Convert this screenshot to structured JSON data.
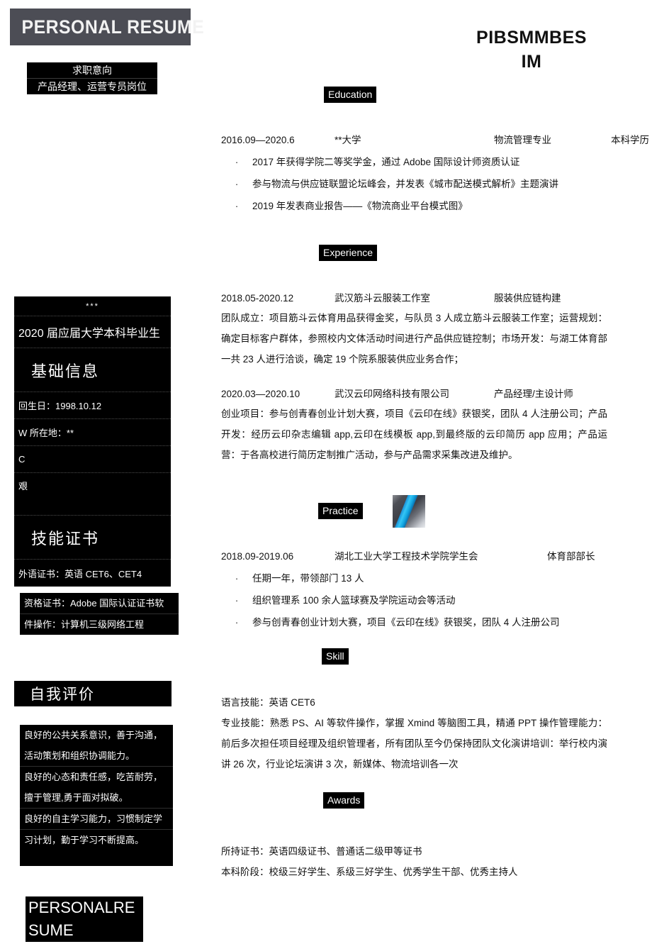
{
  "banner": {
    "title": "PERSONAL RESUME"
  },
  "objective": {
    "heading": "求职意向",
    "value": "产品经理、运营专员岗位"
  },
  "name_header": {
    "line1": "PIBSMMBES",
    "line2": "IM"
  },
  "info_panel": {
    "stars": "***",
    "graduation": "2020 届应届大学本科毕业生",
    "section_title": "基础信息",
    "rows": [
      "回生日：1998.10.12",
      "W 所在地：**",
      "C",
      "艰"
    ],
    "skill_cert_title": "技能证书",
    "foreign_cert": "外语证书：英语 CET6、CET4"
  },
  "cert_box": {
    "rows": [
      "资格证书：Adobe 国际认证证书软",
      "件操作：计算机三级网络工程"
    ]
  },
  "self_eval": {
    "title": "自我评价",
    "rows": [
      "良好的公共关系意识，善于沟通，",
      "活动策划和组织协调能力。",
      "良好的心态和责任感，吃苦耐劳，",
      "擅于管理,勇于面对拟破。",
      "良好的自主学习能力，习惯制定学",
      "习计划，勤于学习不断提高。"
    ]
  },
  "bottom_block": {
    "line1": "PERSONALRE",
    "line2": "SUME"
  },
  "sections": {
    "education": {
      "label": "Education",
      "head": {
        "date": "2016.09—2020.6",
        "org": "**大学",
        "major": "物流管理专业",
        "degree": "本科学历"
      },
      "bullets": [
        "2017 年获得学院二等奖学金，通过 Adobe 国际设计师资质认证",
        "参与物流与供应链联盟论坛峰会，并发表《城市配送模式解析》主题演讲",
        "2019 年发表商业报告——《物流商业平台模式图》"
      ],
      "bullet_dot": "·"
    },
    "experience": {
      "label": "Experience",
      "items": [
        {
          "date": "2018.05-2020.12",
          "org": "武汉筋斗云服装工作室",
          "role": "服装供应链构建",
          "desc": "团队成立：项目筋斗云体育用品获得金奖，与队员 3 人成立筋斗云服装工作室；运营规划：确定目标客户群体，参照校内文体活动时间进行产品供应链控制；市场开发：与湖工体育部一共 23 人进行洽谈，确定 19 个院系服装供应业务合作；"
        },
        {
          "date": "2020.03—2020.10",
          "org": "武汉云印网络科技有限公司",
          "role": "产品经理/主设计师",
          "desc": "创业项目：参与创青春创业计划大赛，项目《云印在线》获银奖，团队 4 人注册公司；产品开发：经历云印杂志编辑 app,云印在线模板 app,到最终版的云印简历 app 应用；产品运营：于各高校进行简历定制推广活动，参与产品需求采集改进及维护。"
        }
      ]
    },
    "practice": {
      "label": "Practice",
      "image_name": "decorative-blue-stripe-image",
      "head": {
        "date": "2018.09-2019.06",
        "org": "湖北工业大学工程技术学院学生会",
        "role": "体育部部长"
      },
      "bullets": [
        "任期一年，带领部门 13 人",
        "组织管理系 100 余人篮球赛及学院运动会等活动",
        "参与创青春创业计划大赛，项目《云印在线》获银奖，团队 4 人注册公司"
      ],
      "bullet_dot": "·"
    },
    "skill": {
      "label": "Skill",
      "lines": [
        "语言技能：英语 CET6",
        "专业技能：熟悉 PS、AI 等软件操作，掌握 Xmind 等脑图工具，精通 PPT 操作管理能力：前后多次担任项目经理及组织管理者，所有团队至今仍保持团队文化演讲培训：举行校内演讲 26 次，行业论坛演讲 3 次，新媒体、物流培训各一次"
      ],
      "line1": "语言技能：英语 CET6",
      "para": "专业技能：熟悉 PS、AI 等软件操作，掌握 Xmind 等脑图工具，精通 PPT 操作管理能力：前后多次担任项目经理及组织管理者，所有团队至今仍保持团队文化演讲培训：举行校内演讲 26 次，行业论坛演讲 3 次，新媒体、物流培训各一次"
    },
    "awards": {
      "label": "Awards",
      "lines": [
        "所持证书：英语四级证书、普通话二级甲等证书",
        "本科阶段：校级三好学生、系级三好学生、优秀学生干部、优秀主持人"
      ]
    }
  },
  "colors": {
    "banner_bg": "#4c4d55",
    "block_bg": "#000000",
    "accent_blue": "#35c6f5",
    "text": "#1a1a1a"
  }
}
